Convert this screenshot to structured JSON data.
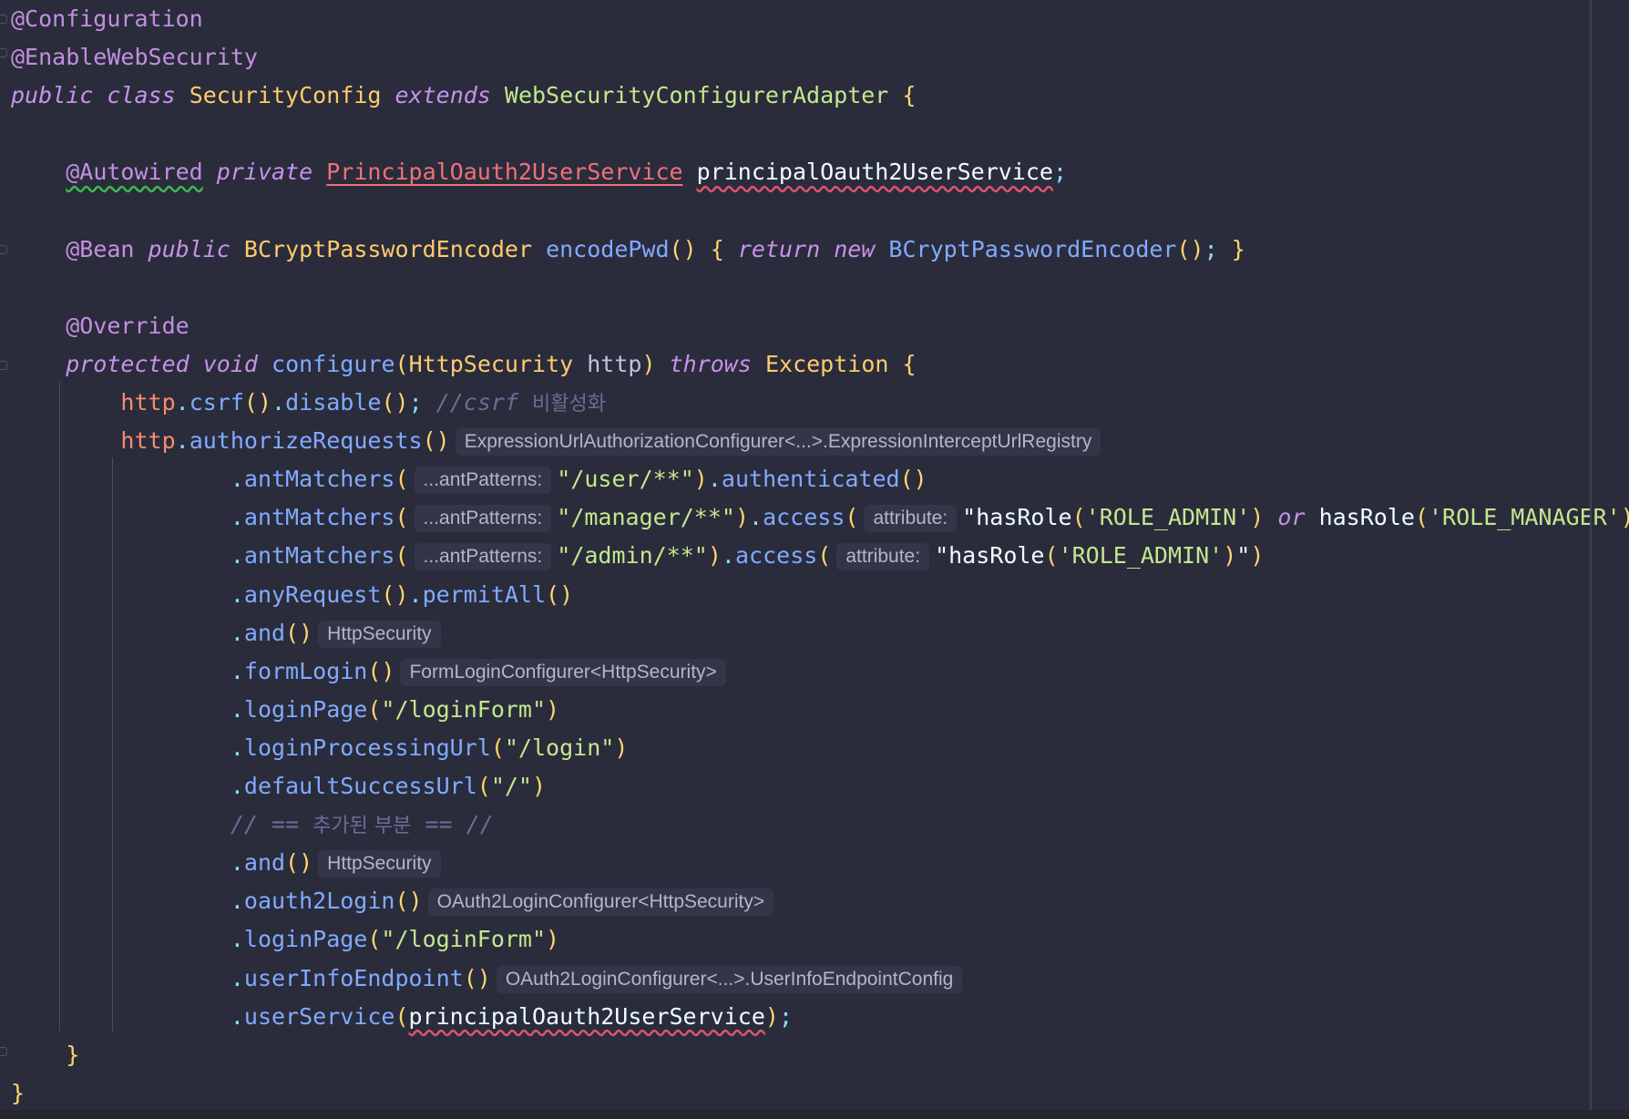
{
  "editor": {
    "lines": [
      {
        "tokens": [
          {
            "c": "ann",
            "t": "@Configuration"
          }
        ]
      },
      {
        "tokens": [
          {
            "c": "ann",
            "t": "@EnableWebSecurity"
          }
        ]
      },
      {
        "tokens": [
          {
            "c": "kw",
            "t": "public"
          },
          {
            "c": "txt",
            "t": " "
          },
          {
            "c": "kw",
            "t": "class"
          },
          {
            "c": "txt",
            "t": " "
          },
          {
            "c": "cls",
            "t": "SecurityConfig"
          },
          {
            "c": "txt",
            "t": " "
          },
          {
            "c": "kw",
            "t": "extends"
          },
          {
            "c": "txt",
            "t": " "
          },
          {
            "c": "str",
            "t": "WebSecurityConfigurerAdapter"
          },
          {
            "c": "txt",
            "t": " "
          },
          {
            "c": "br",
            "t": "{"
          }
        ]
      },
      {
        "tokens": []
      },
      {
        "tokens": [
          {
            "c": "txt",
            "t": "    "
          },
          {
            "c": "ann warn",
            "t": "@Autowired"
          },
          {
            "c": "txt",
            "t": " "
          },
          {
            "c": "kw",
            "t": "private"
          },
          {
            "c": "txt",
            "t": " "
          },
          {
            "c": "cls-u",
            "t": "PrincipalOauth2UserService"
          },
          {
            "c": "txt",
            "t": " "
          },
          {
            "c": "txt err",
            "t": "principalOauth2UserService"
          },
          {
            "c": "pun",
            "t": ";"
          }
        ]
      },
      {
        "tokens": []
      },
      {
        "tokens": [
          {
            "c": "txt",
            "t": "    "
          },
          {
            "c": "ann",
            "t": "@Bean"
          },
          {
            "c": "txt",
            "t": " "
          },
          {
            "c": "kw",
            "t": "public"
          },
          {
            "c": "txt",
            "t": " "
          },
          {
            "c": "cls",
            "t": "BCryptPasswordEncoder"
          },
          {
            "c": "txt",
            "t": " "
          },
          {
            "c": "fn",
            "t": "encodePwd"
          },
          {
            "c": "br",
            "t": "()"
          },
          {
            "c": "txt",
            "t": " "
          },
          {
            "c": "br",
            "t": "{"
          },
          {
            "c": "txt",
            "t": " "
          },
          {
            "c": "kw",
            "t": "return"
          },
          {
            "c": "txt",
            "t": " "
          },
          {
            "c": "kw",
            "t": "new"
          },
          {
            "c": "txt",
            "t": " "
          },
          {
            "c": "fn",
            "t": "BCryptPasswordEncoder"
          },
          {
            "c": "br",
            "t": "()"
          },
          {
            "c": "pun",
            "t": ";"
          },
          {
            "c": "txt",
            "t": " "
          },
          {
            "c": "br",
            "t": "}"
          }
        ]
      },
      {
        "tokens": []
      },
      {
        "tokens": [
          {
            "c": "txt",
            "t": "    "
          },
          {
            "c": "ann",
            "t": "@Override"
          }
        ]
      },
      {
        "tokens": [
          {
            "c": "txt",
            "t": "    "
          },
          {
            "c": "kw",
            "t": "protected"
          },
          {
            "c": "txt",
            "t": " "
          },
          {
            "c": "kw",
            "t": "void"
          },
          {
            "c": "txt",
            "t": " "
          },
          {
            "c": "fn",
            "t": "configure"
          },
          {
            "c": "br",
            "t": "("
          },
          {
            "c": "cls",
            "t": "HttpSecurity"
          },
          {
            "c": "txt",
            "t": " "
          },
          {
            "c": "par",
            "t": "http"
          },
          {
            "c": "br",
            "t": ")"
          },
          {
            "c": "txt",
            "t": " "
          },
          {
            "c": "kw",
            "t": "throws"
          },
          {
            "c": "txt",
            "t": " "
          },
          {
            "c": "cls",
            "t": "Exception"
          },
          {
            "c": "txt",
            "t": " "
          },
          {
            "c": "br",
            "t": "{"
          }
        ]
      },
      {
        "tokens": [
          {
            "c": "txt",
            "t": "        "
          },
          {
            "c": "var",
            "t": "http"
          },
          {
            "c": "pun",
            "t": "."
          },
          {
            "c": "fn",
            "t": "csrf"
          },
          {
            "c": "br",
            "t": "()"
          },
          {
            "c": "pun",
            "t": "."
          },
          {
            "c": "fn",
            "t": "disable"
          },
          {
            "c": "br",
            "t": "()"
          },
          {
            "c": "pun",
            "t": ";"
          },
          {
            "c": "txt",
            "t": " "
          },
          {
            "c": "com",
            "t": "//csrf "
          },
          {
            "c": "comk",
            "t": "비활성화"
          }
        ]
      },
      {
        "tokens": [
          {
            "c": "txt",
            "t": "        "
          },
          {
            "c": "var",
            "t": "http"
          },
          {
            "c": "pun",
            "t": "."
          },
          {
            "c": "fn",
            "t": "authorizeRequests"
          },
          {
            "c": "br",
            "t": "()"
          },
          {
            "c": "hint",
            "t": "ExpressionUrlAuthorizationConfigurer<...>.ExpressionInterceptUrlRegistry"
          }
        ]
      },
      {
        "tokens": [
          {
            "c": "txt",
            "t": "                "
          },
          {
            "c": "pun",
            "t": "."
          },
          {
            "c": "fn",
            "t": "antMatchers"
          },
          {
            "c": "br",
            "t": "("
          },
          {
            "c": "hint",
            "t": "...antPatterns:"
          },
          {
            "c": "str",
            "t": "\"/user/**\""
          },
          {
            "c": "br",
            "t": ")"
          },
          {
            "c": "pun",
            "t": "."
          },
          {
            "c": "fn",
            "t": "authenticated"
          },
          {
            "c": "br",
            "t": "()"
          }
        ]
      },
      {
        "tokens": [
          {
            "c": "txt",
            "t": "                "
          },
          {
            "c": "pun",
            "t": "."
          },
          {
            "c": "fn",
            "t": "antMatchers"
          },
          {
            "c": "br",
            "t": "("
          },
          {
            "c": "hint",
            "t": "...antPatterns:"
          },
          {
            "c": "str",
            "t": "\"/manager/**\""
          },
          {
            "c": "br",
            "t": ")"
          },
          {
            "c": "pun",
            "t": "."
          },
          {
            "c": "fn",
            "t": "access"
          },
          {
            "c": "br",
            "t": "("
          },
          {
            "c": "hint",
            "t": "attribute:"
          },
          {
            "c": "txt",
            "t": "\"hasRole"
          },
          {
            "c": "br",
            "t": "("
          },
          {
            "c": "str",
            "t": "'ROLE_ADMIN'"
          },
          {
            "c": "br",
            "t": ")"
          },
          {
            "c": "txt",
            "t": " "
          },
          {
            "c": "kw",
            "t": "or"
          },
          {
            "c": "txt",
            "t": " hasRole"
          },
          {
            "c": "br",
            "t": "("
          },
          {
            "c": "str",
            "t": "'ROLE_MANAGER'"
          },
          {
            "c": "br",
            "t": ")"
          },
          {
            "c": "txt",
            "t": "\""
          },
          {
            "c": "br",
            "t": ")"
          }
        ]
      },
      {
        "tokens": [
          {
            "c": "txt",
            "t": "                "
          },
          {
            "c": "pun",
            "t": "."
          },
          {
            "c": "fn",
            "t": "antMatchers"
          },
          {
            "c": "br",
            "t": "("
          },
          {
            "c": "hint",
            "t": "...antPatterns:"
          },
          {
            "c": "str",
            "t": "\"/admin/**\""
          },
          {
            "c": "br",
            "t": ")"
          },
          {
            "c": "pun",
            "t": "."
          },
          {
            "c": "fn",
            "t": "access"
          },
          {
            "c": "br",
            "t": "("
          },
          {
            "c": "hint",
            "t": "attribute:"
          },
          {
            "c": "txt",
            "t": "\"hasRole"
          },
          {
            "c": "br",
            "t": "("
          },
          {
            "c": "str",
            "t": "'ROLE_ADMIN'"
          },
          {
            "c": "br",
            "t": ")"
          },
          {
            "c": "txt",
            "t": "\""
          },
          {
            "c": "br",
            "t": ")"
          }
        ]
      },
      {
        "tokens": [
          {
            "c": "txt",
            "t": "                "
          },
          {
            "c": "pun",
            "t": "."
          },
          {
            "c": "fn",
            "t": "anyRequest"
          },
          {
            "c": "br",
            "t": "()"
          },
          {
            "c": "pun",
            "t": "."
          },
          {
            "c": "fn",
            "t": "permitAll"
          },
          {
            "c": "br",
            "t": "()"
          }
        ]
      },
      {
        "tokens": [
          {
            "c": "txt",
            "t": "                "
          },
          {
            "c": "pun",
            "t": "."
          },
          {
            "c": "fn",
            "t": "and"
          },
          {
            "c": "br",
            "t": "()"
          },
          {
            "c": "hint",
            "t": "HttpSecurity"
          }
        ]
      },
      {
        "tokens": [
          {
            "c": "txt",
            "t": "                "
          },
          {
            "c": "pun",
            "t": "."
          },
          {
            "c": "fn",
            "t": "formLogin"
          },
          {
            "c": "br",
            "t": "()"
          },
          {
            "c": "hint",
            "t": "FormLoginConfigurer<HttpSecurity>"
          }
        ]
      },
      {
        "tokens": [
          {
            "c": "txt",
            "t": "                "
          },
          {
            "c": "pun",
            "t": "."
          },
          {
            "c": "fn",
            "t": "loginPage"
          },
          {
            "c": "br",
            "t": "("
          },
          {
            "c": "str",
            "t": "\"/loginForm\""
          },
          {
            "c": "br",
            "t": ")"
          }
        ]
      },
      {
        "tokens": [
          {
            "c": "txt",
            "t": "                "
          },
          {
            "c": "pun",
            "t": "."
          },
          {
            "c": "fn",
            "t": "loginProcessingUrl"
          },
          {
            "c": "br",
            "t": "("
          },
          {
            "c": "str",
            "t": "\"/login\""
          },
          {
            "c": "br",
            "t": ")"
          }
        ]
      },
      {
        "tokens": [
          {
            "c": "txt",
            "t": "                "
          },
          {
            "c": "pun",
            "t": "."
          },
          {
            "c": "fn",
            "t": "defaultSuccessUrl"
          },
          {
            "c": "br",
            "t": "("
          },
          {
            "c": "str",
            "t": "\"/\""
          },
          {
            "c": "br",
            "t": ")"
          }
        ]
      },
      {
        "tokens": [
          {
            "c": "txt",
            "t": "                "
          },
          {
            "c": "com",
            "t": "// == "
          },
          {
            "c": "comk",
            "t": "추가된 부분"
          },
          {
            "c": "com",
            "t": " == //"
          }
        ]
      },
      {
        "tokens": [
          {
            "c": "txt",
            "t": "                "
          },
          {
            "c": "pun",
            "t": "."
          },
          {
            "c": "fn",
            "t": "and"
          },
          {
            "c": "br",
            "t": "()"
          },
          {
            "c": "hint",
            "t": "HttpSecurity"
          }
        ]
      },
      {
        "tokens": [
          {
            "c": "txt",
            "t": "                "
          },
          {
            "c": "pun",
            "t": "."
          },
          {
            "c": "fn",
            "t": "oauth2Login"
          },
          {
            "c": "br",
            "t": "()"
          },
          {
            "c": "hint",
            "t": "OAuth2LoginConfigurer<HttpSecurity>"
          }
        ]
      },
      {
        "tokens": [
          {
            "c": "txt",
            "t": "                "
          },
          {
            "c": "pun",
            "t": "."
          },
          {
            "c": "fn",
            "t": "loginPage"
          },
          {
            "c": "br",
            "t": "("
          },
          {
            "c": "str",
            "t": "\"/loginForm\""
          },
          {
            "c": "br",
            "t": ")"
          }
        ]
      },
      {
        "tokens": [
          {
            "c": "txt",
            "t": "                "
          },
          {
            "c": "pun",
            "t": "."
          },
          {
            "c": "fn",
            "t": "userInfoEndpoint"
          },
          {
            "c": "br",
            "t": "()"
          },
          {
            "c": "hint",
            "t": "OAuth2LoginConfigurer<...>.UserInfoEndpointConfig"
          }
        ]
      },
      {
        "tokens": [
          {
            "c": "txt",
            "t": "                "
          },
          {
            "c": "pun",
            "t": "."
          },
          {
            "c": "fn",
            "t": "userService"
          },
          {
            "c": "br",
            "t": "("
          },
          {
            "c": "txt err",
            "t": "principalOauth2UserService"
          },
          {
            "c": "br",
            "t": ")"
          },
          {
            "c": "pun",
            "t": ";"
          }
        ]
      },
      {
        "tokens": [
          {
            "c": "txt",
            "t": "    "
          },
          {
            "c": "br",
            "t": "}"
          }
        ]
      },
      {
        "tokens": [
          {
            "c": "br",
            "t": "}"
          }
        ]
      }
    ]
  }
}
